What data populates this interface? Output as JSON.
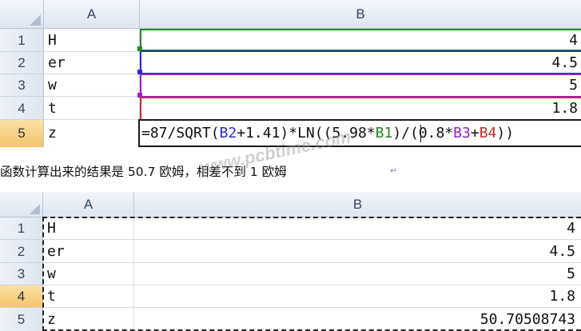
{
  "top_sheet": {
    "columns": [
      "A",
      "B"
    ],
    "rows": [
      {
        "num": "1",
        "a": "H",
        "b": "4"
      },
      {
        "num": "2",
        "a": "er",
        "b": "4.5"
      },
      {
        "num": "3",
        "a": "w",
        "b": "5"
      },
      {
        "num": "4",
        "a": "t",
        "b": "1.8"
      },
      {
        "num": "5",
        "a": "z"
      }
    ],
    "formula": [
      {
        "text": "=87/SQRT(",
        "color": "#111111"
      },
      {
        "text": "B2",
        "color": "#2b2bd0"
      },
      {
        "text": "+1.41)*LN((5.98*",
        "color": "#111111"
      },
      {
        "text": "B1",
        "color": "#1f8a1f"
      },
      {
        "text": ")/(0.8*",
        "color": "#111111"
      },
      {
        "text": "B3",
        "color": "#a020c0"
      },
      {
        "text": "+",
        "color": "#111111"
      },
      {
        "text": "B4",
        "color": "#c0302a"
      },
      {
        "text": "))",
        "color": "#111111"
      }
    ],
    "ref_colors": {
      "b1": "#1f8a1f",
      "b2": "#2b2bd0",
      "b3": "#a020c0",
      "b4": "#c0302a"
    }
  },
  "caption": "函数计算出来的结果是 50.7 欧姆，相差不到 1 欧姆",
  "watermark": "www.pcbtime.com",
  "bottom_sheet": {
    "columns": [
      "A",
      "B"
    ],
    "rows": [
      {
        "num": "1",
        "a": "H",
        "b": "4"
      },
      {
        "num": "2",
        "a": "er",
        "b": "4.5"
      },
      {
        "num": "3",
        "a": "w",
        "b": "5"
      },
      {
        "num": "4",
        "a": "t",
        "b": "1.8"
      },
      {
        "num": "5",
        "a": "z",
        "b": "50.70508743"
      }
    ]
  },
  "colors": {
    "selected_header": "#f5c56a",
    "grid": "#d4dbe4",
    "header": "#dde5ef"
  }
}
